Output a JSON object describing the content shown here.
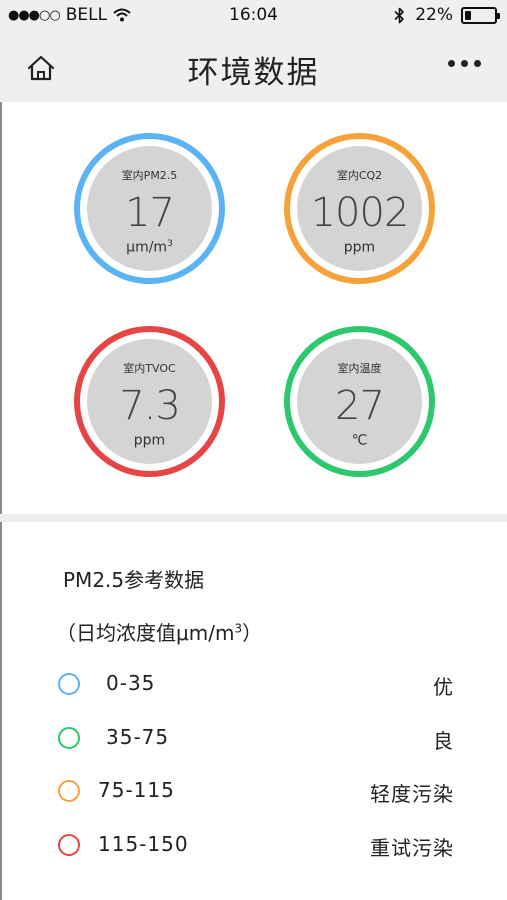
{
  "status_bar": {
    "signal": "●●●○○",
    "carrier": "BELL",
    "time": "16:04",
    "battery_percent": "22%",
    "battery_level": 0.22
  },
  "nav": {
    "title": "环境数据",
    "home_icon": "home-icon",
    "more_icon": "more-icon"
  },
  "gauges": [
    {
      "label": "室内PM2.5",
      "value": "17",
      "unit": "μm/m",
      "unit_sup": "3",
      "color": "#5ab4f4"
    },
    {
      "label": "室内CQ2",
      "value": "1002",
      "unit": "ppm",
      "unit_sup": "",
      "color": "#f5a23a"
    },
    {
      "label": "室内TVOC",
      "value": "7.3",
      "unit": "ppm",
      "unit_sup": "",
      "color": "#e54545"
    },
    {
      "label": "室内温度",
      "value": "27",
      "unit": "℃",
      "unit_sup": "",
      "color": "#2dc76d"
    }
  ],
  "legend": {
    "title": "PM2.5参考数据",
    "subtitle": "（日均浓度值μm/m",
    "subtitle_sup": "3",
    "subtitle_end": "）",
    "rows": [
      {
        "range": "0-35",
        "level": "优",
        "color": "#5ab4f4"
      },
      {
        "range": "35-75",
        "level": "良",
        "color": "#2dc76d"
      },
      {
        "range": "75-115",
        "level": "轻度污染",
        "color": "#f5a23a"
      },
      {
        "range": "115-150",
        "level": "重试污染",
        "color": "#e54545"
      }
    ]
  }
}
